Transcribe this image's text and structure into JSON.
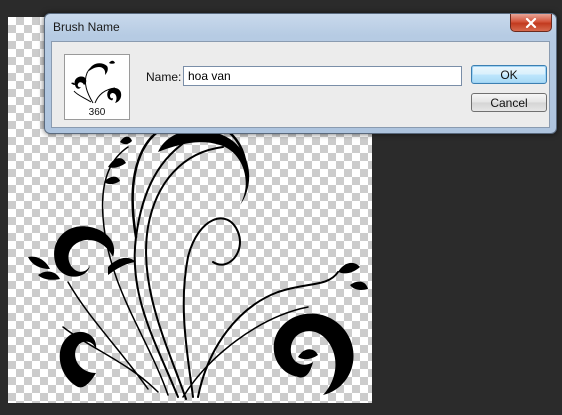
{
  "dialog": {
    "title": "Brush Name",
    "close_icon": "close-icon",
    "brush_preview": {
      "size": "360"
    },
    "name_label": "Name:",
    "name_value": "hoa van",
    "ok_label": "OK",
    "cancel_label": "Cancel"
  },
  "colors": {
    "canvas_background": "#2b2b2b",
    "checker_light": "#ffffff",
    "checker_dark": "#cccccc",
    "ornament": "#000000",
    "dialog_frame": "#b6cbe3",
    "close_button": "#c23a1f"
  }
}
